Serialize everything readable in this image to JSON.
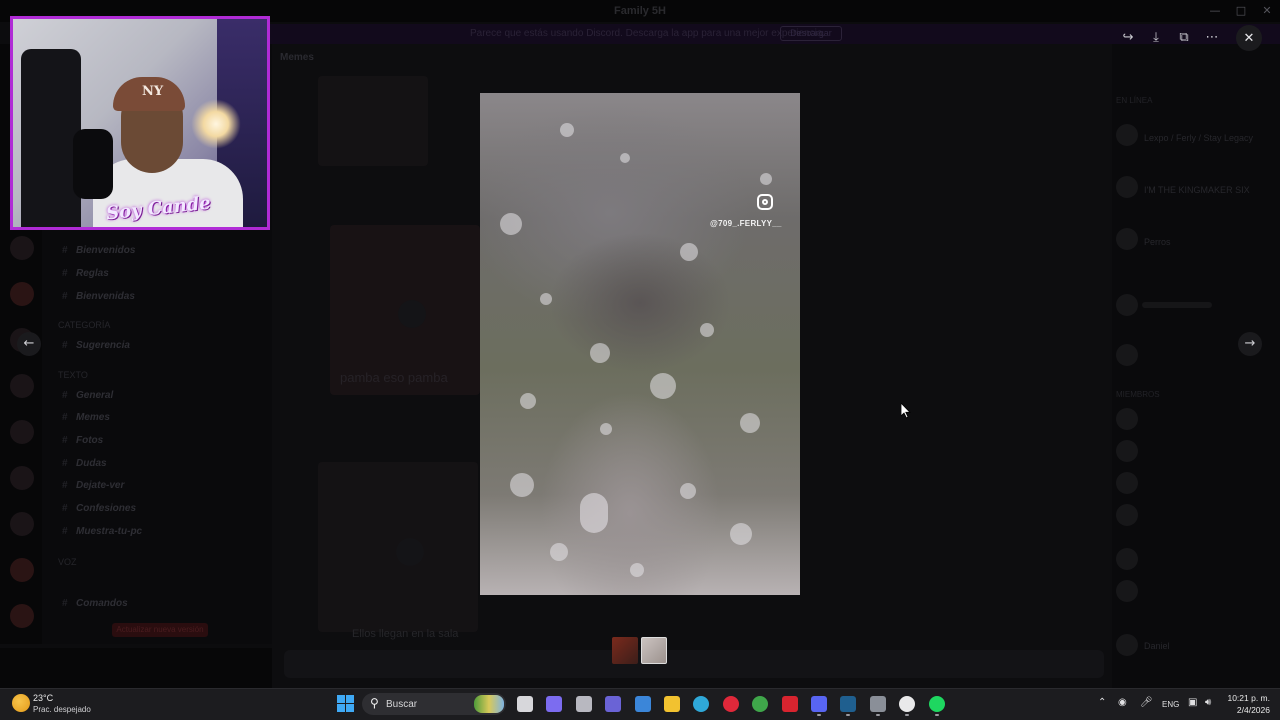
{
  "window": {
    "title": "Family 5H",
    "minimize_icon": "minimize-icon",
    "maximize_icon": "maximize-icon",
    "close_icon": "close-icon"
  },
  "banner": {
    "text": "Parece que estás usando Discord. Descarga la app para una mejor experiencia.",
    "button_label": "Descargar"
  },
  "channels": {
    "categories": [
      "Categoría",
      "Texto",
      "Voz"
    ],
    "items": [
      {
        "label": "Bienvenidos",
        "icon": "hash-icon"
      },
      {
        "label": "Reglas",
        "icon": "hash-icon"
      },
      {
        "label": "Bienvenidas",
        "icon": "hash-icon"
      },
      {
        "label": "Sugerencia",
        "icon": "hash-icon"
      },
      {
        "label": "General",
        "icon": "hash-icon"
      },
      {
        "label": "Memes",
        "icon": "hash-icon"
      },
      {
        "label": "Fotos",
        "icon": "hash-icon"
      },
      {
        "label": "Dudas",
        "icon": "hash-icon"
      },
      {
        "label": "Dejate-ver",
        "icon": "hash-icon"
      },
      {
        "label": "Confesiones",
        "icon": "hash-icon"
      },
      {
        "label": "Muestra-tu-pc",
        "icon": "hash-icon"
      },
      {
        "label": "Comandos",
        "icon": "hash-icon"
      }
    ],
    "notice": "Actualizar nueva versión"
  },
  "chat": {
    "channel_name": "Memes",
    "caption_1": "pamba eso pamba",
    "caption_2": "Ellos llegan en la sala"
  },
  "members": {
    "label_1": "En línea",
    "label_2": "Miembros",
    "names": [
      "Lexpo / Ferly / Stay Legacy",
      "I'M THE KINGMAKER SIX",
      "Perros",
      "Daniel"
    ]
  },
  "webcam": {
    "overlay_text": "Soy Cande",
    "cap_logo": "NY"
  },
  "viewer": {
    "toolbar_icons": [
      "forward-icon",
      "download-icon",
      "open-external-icon",
      "more-icon"
    ],
    "close_icon": "close-icon",
    "prev_icon": "arrow-left-icon",
    "next_icon": "arrow-right-icon",
    "watermark_icon": "instagram-icon",
    "watermark_handle": "@709_.FERLYY__"
  },
  "taskbar": {
    "weather_temp": "23°C",
    "weather_desc": "Prac. despejado",
    "search_placeholder": "Buscar",
    "language": "ENG",
    "time": "10:21 p. m.",
    "date": "2/4/2026",
    "apps": [
      {
        "name": "task-view-icon",
        "color": "#d7d7db"
      },
      {
        "name": "copilot-icon",
        "color": "#7c6cf0"
      },
      {
        "name": "ai-assistant-icon",
        "color": "#b8b8c0"
      },
      {
        "name": "teams-icon",
        "color": "#6a63d6"
      },
      {
        "name": "store-icon",
        "color": "#3b86d9"
      },
      {
        "name": "file-explorer-icon",
        "color": "#f2c230"
      },
      {
        "name": "edge-icon",
        "color": "#2fa8d8"
      },
      {
        "name": "opera-icon",
        "color": "#e0283a"
      },
      {
        "name": "chrome-icon",
        "color": "#3fa64a"
      },
      {
        "name": "acrobat-icon",
        "color": "#d8242f"
      },
      {
        "name": "discord-icon",
        "color": "#5865f2"
      },
      {
        "name": "steam-icon",
        "color": "#1f5f8f"
      },
      {
        "name": "settings-icon",
        "color": "#8a8f98"
      },
      {
        "name": "obs-icon",
        "color": "#e9e9ea"
      },
      {
        "name": "spotify-icon",
        "color": "#1ed760"
      }
    ]
  }
}
